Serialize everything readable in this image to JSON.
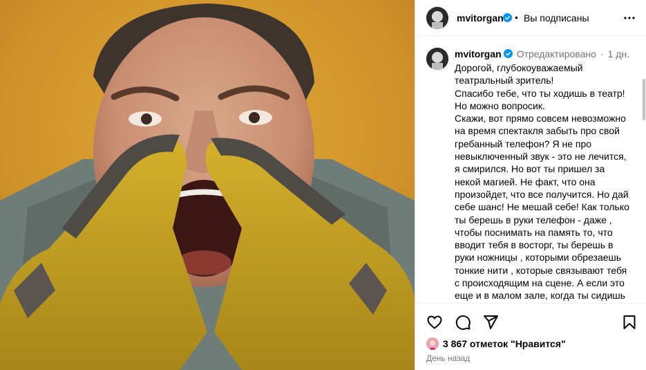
{
  "post": {
    "username": "mvitorgan",
    "follow_separator": "•",
    "follow_status": "Вы подписаны"
  },
  "icons": {
    "verified": "verified-badge-icon",
    "more": "more-options-icon",
    "like": "heart-icon",
    "comment": "comment-bubble-icon",
    "share": "paper-plane-icon",
    "save": "bookmark-icon"
  },
  "colors": {
    "verified_blue": "#0095f6",
    "muted_text": "#737373",
    "background_orange": "#d59a2a",
    "glove_yellow": "#c9a51f"
  },
  "caption": {
    "username": "mvitorgan",
    "edited": "Отредактировано",
    "separator": "·",
    "time": "1 дн.",
    "text": "Дорогой, глубокоуважаемый\nтеатральный зритель!\nСпасибо тебе, что ты ходишь в театр!\nНо можно вопросик.\nСкажи, вот прямо совсем невозможно\nна время спектакля забыть про свой\nгребанный телефон? Я не про\nневыключенный звук - это не лечится,\nя смирился. Но вот ты пришел за\nнекой магией. Не факт, что она\nпроизойдет, что все получится. Но дай\nсебе шанс! Не мешай себе! Как только\nты берешь в руки телефон - даже ,\n чтобы поснимать на память то, что\nвводит тебя в восторг, ты берешь в\nруки ножницы , которыми обрезаешь\nтонкие нити , которые связывают тебя\nс происходящим на сцене. А если это\nеще и в малом зале, когда ты сидишь\nвот тут перед актером"
  },
  "footer": {
    "likes": "3 867 отметок \"Нравится\"",
    "date": "День назад"
  }
}
